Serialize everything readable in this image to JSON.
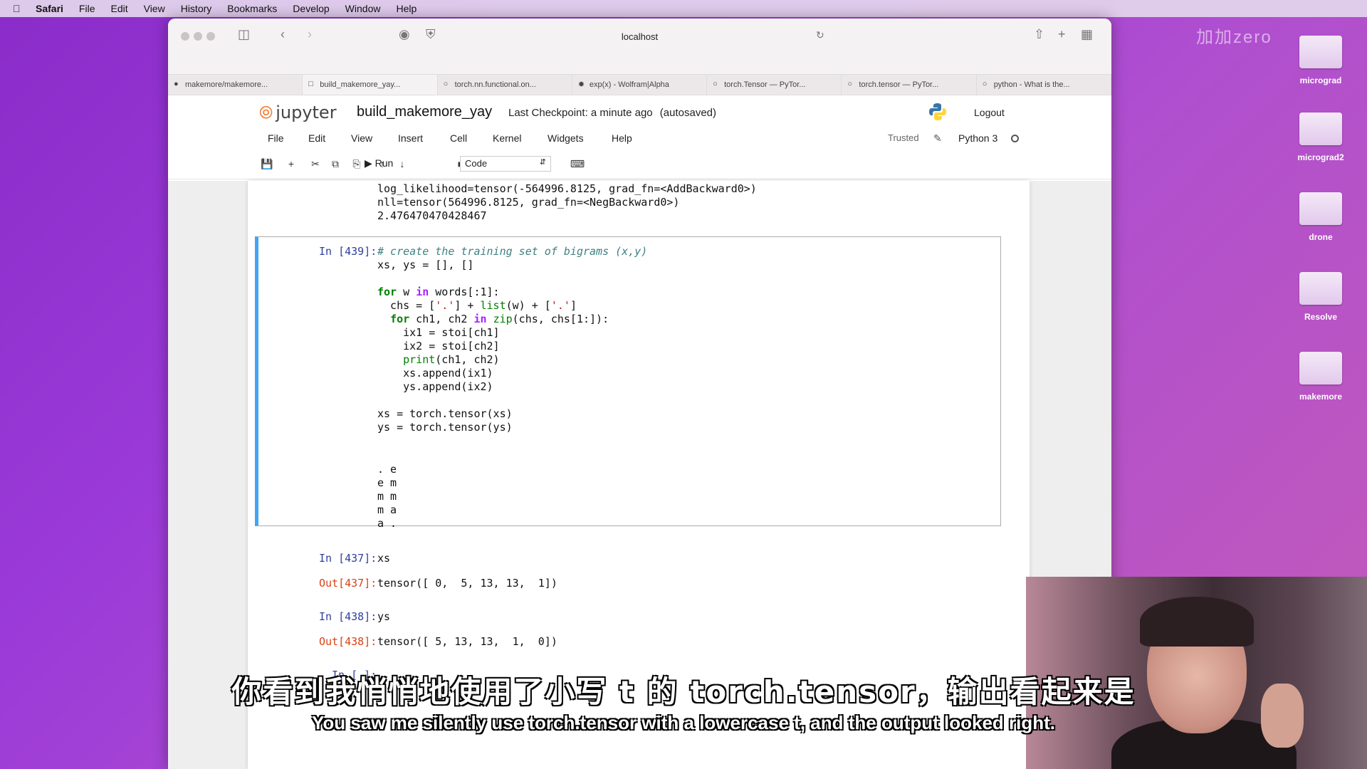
{
  "menubar": {
    "app": "Safari",
    "items": [
      "File",
      "Edit",
      "View",
      "History",
      "Bookmarks",
      "Develop",
      "Window",
      "Help"
    ]
  },
  "watermark": "加加zero",
  "desktop_icons": [
    "micrograd",
    "micrograd2",
    "drone",
    "Resolve",
    "makemore"
  ],
  "browser": {
    "url": "localhost",
    "tabs": [
      "makemore/makemore...",
      "build_makemore_yay...",
      "torch.nn.functional.on...",
      "exp(x) - Wolfram|Alpha",
      "torch.Tensor — PyTor...",
      "torch.tensor — PyTor...",
      "python - What is the..."
    ]
  },
  "jupyter": {
    "logo_text": "jupyter",
    "notebook_name": "build_makemore_yay",
    "checkpoint": "Last Checkpoint: a minute ago",
    "autosaved": "(autosaved)",
    "logout": "Logout",
    "menu": [
      "File",
      "Edit",
      "View",
      "Insert",
      "Cell",
      "Kernel",
      "Widgets",
      "Help"
    ],
    "trusted": "Trusted",
    "kernel": "Python 3",
    "toolbar": {
      "run": "Run",
      "cell_type": "Code"
    }
  },
  "cells": {
    "prev_output": [
      "log_likelihood=tensor(-564996.8125, grad_fn=<AddBackward0>)",
      "nll=tensor(564996.8125, grad_fn=<NegBackward0>)",
      "2.476470470428467"
    ],
    "cell439": {
      "prompt": "In [439]:",
      "output": [
        ". e",
        "e m",
        "m m",
        "m a",
        "a ."
      ]
    },
    "cell437": {
      "prompt": "In [437]:",
      "code": "xs",
      "out_prompt": "Out[437]:",
      "output": "tensor([ 0,  5, 13, 13,  1])"
    },
    "cell438": {
      "prompt": "In [438]:",
      "code": "ys",
      "out_prompt": "Out[438]:",
      "output": "tensor([ 5, 13, 13,  1,  0])"
    },
    "empty": {
      "prompt": "In [ ]:"
    }
  },
  "subtitles": {
    "zh": "你看到我悄悄地使用了小写 t 的 torch.tensor，输出看起来是",
    "en": "You saw me silently use torch.tensor with a lowercase t, and the output looked right."
  }
}
